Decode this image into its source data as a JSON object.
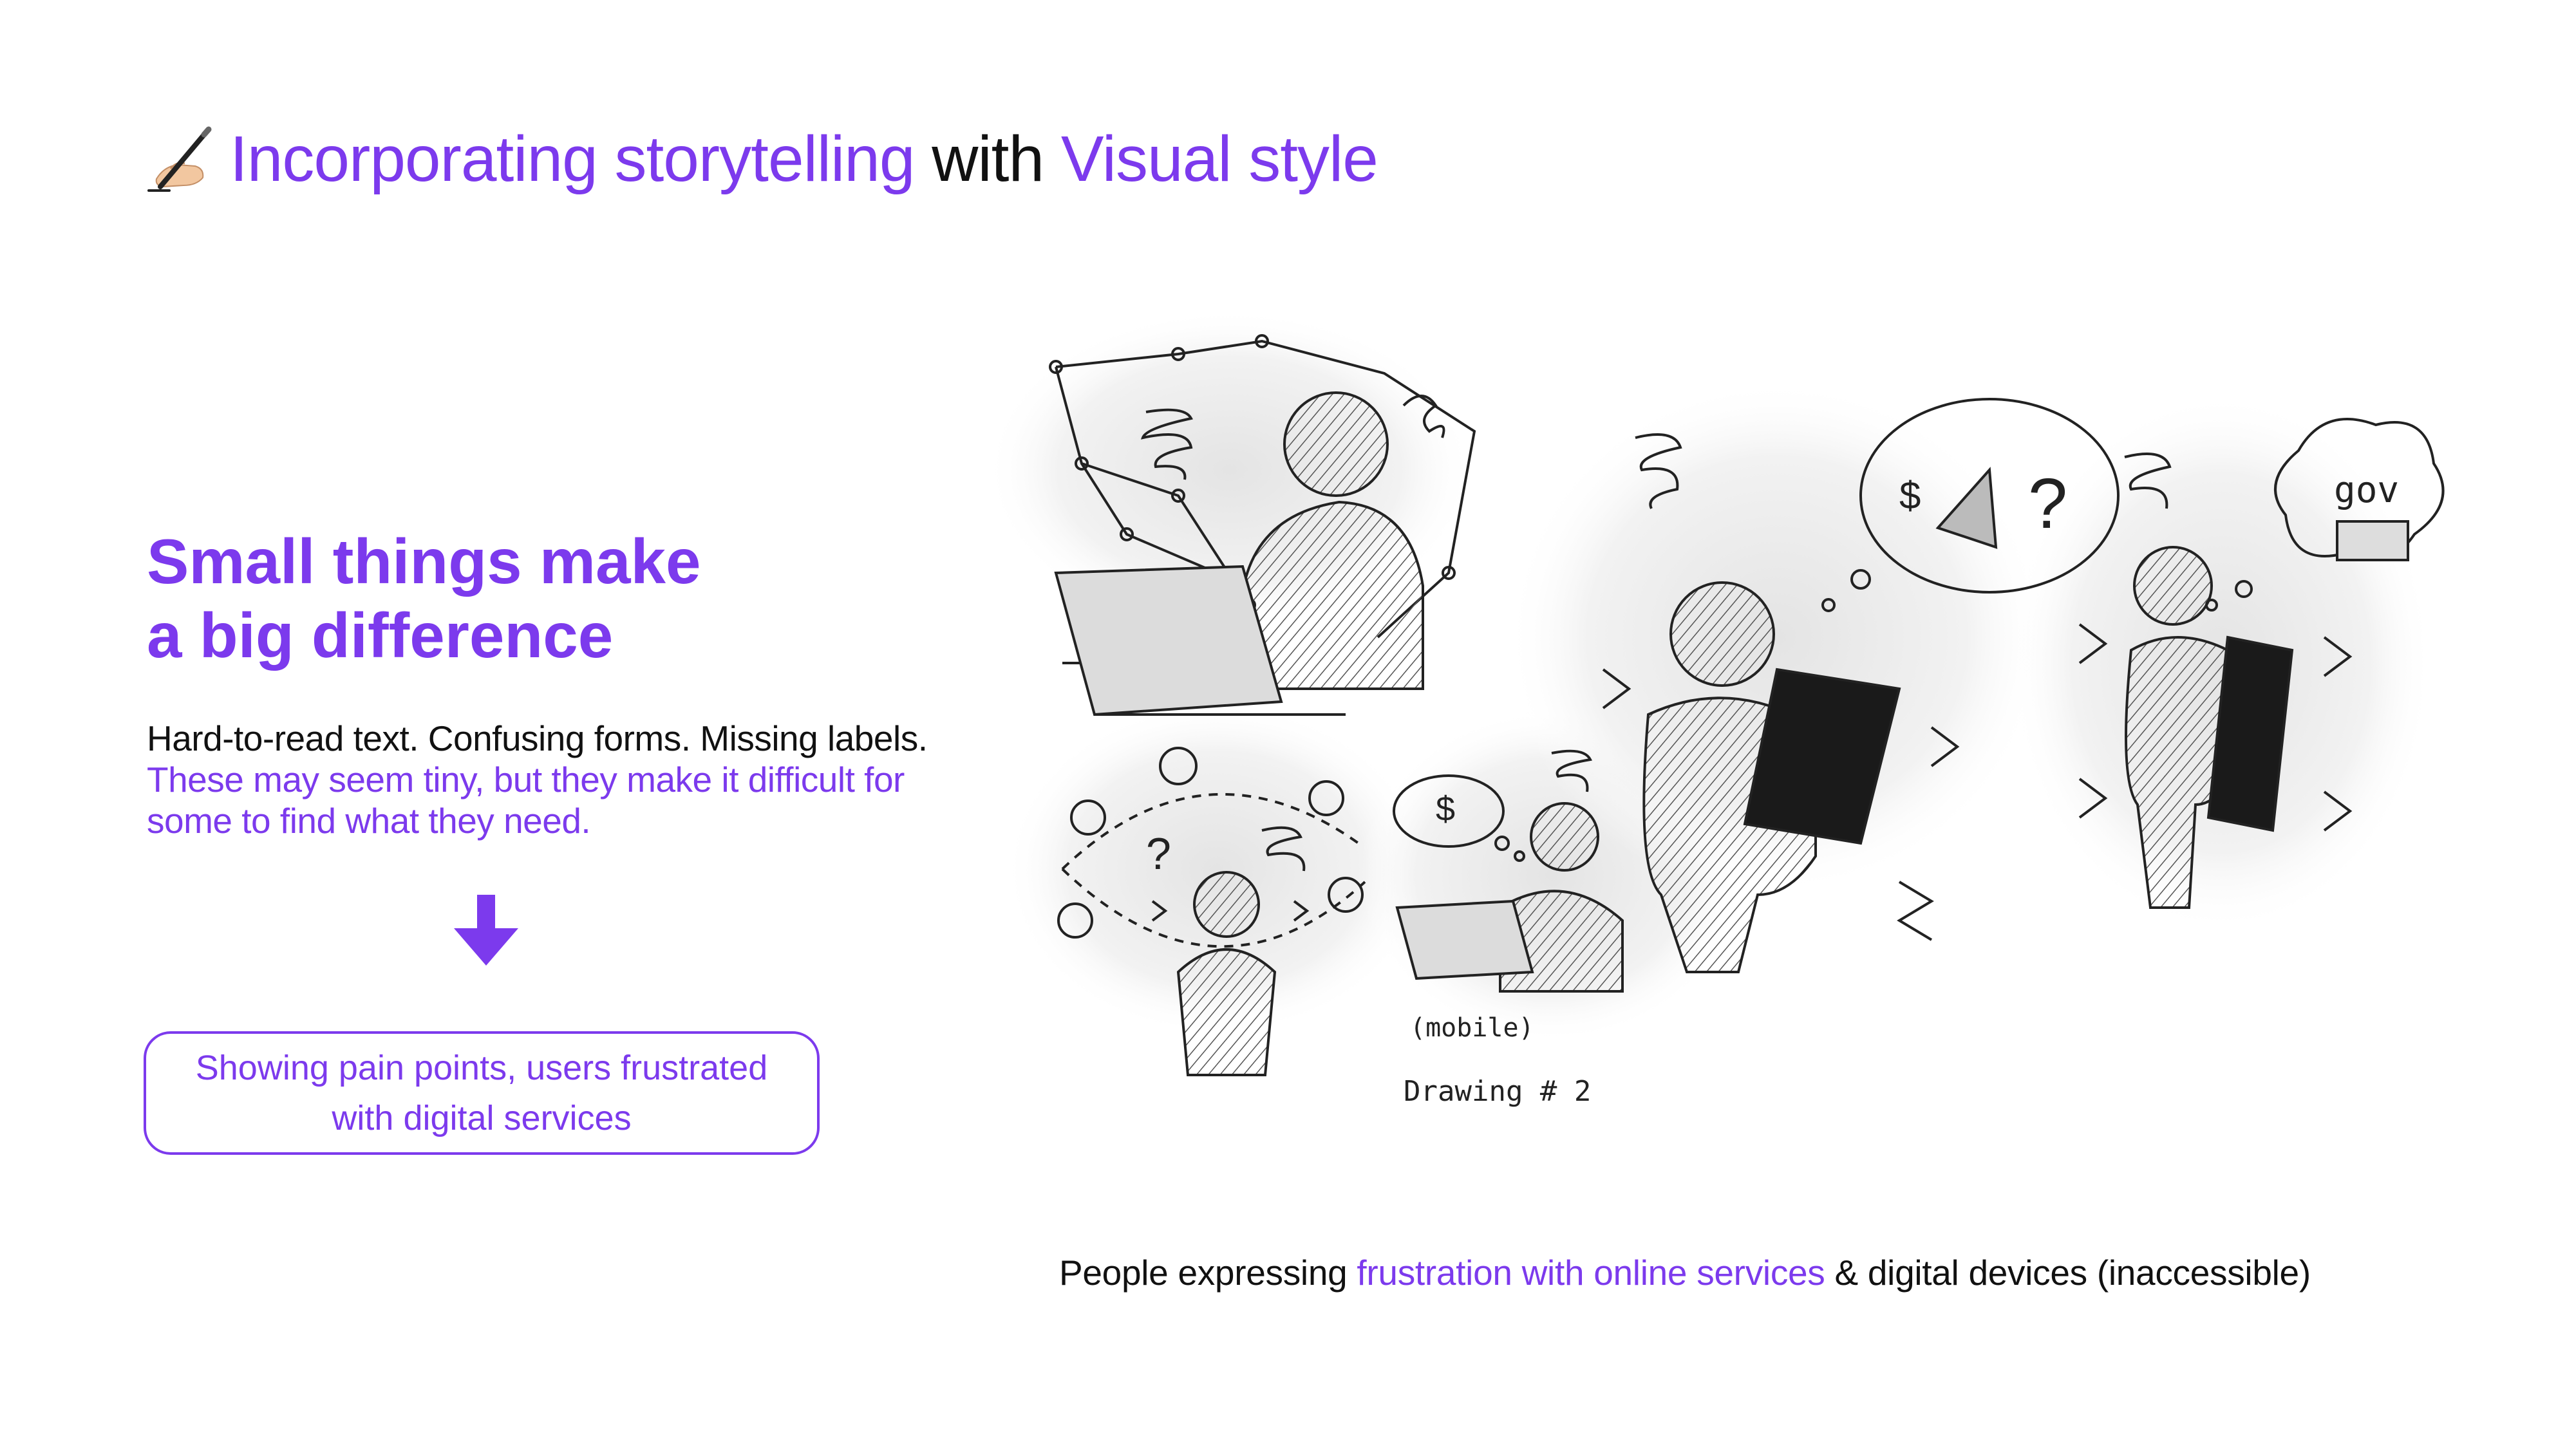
{
  "title": {
    "icon": "writing-hand-icon",
    "part1": "Incorporating storytelling",
    "part2": "with",
    "part3": "Visual style"
  },
  "headline": {
    "line1": "Small things make",
    "line2": "a big difference"
  },
  "body": {
    "plain": "Hard-to-read text. Confusing forms. Missing labels.",
    "highlight": "These may seem tiny, but they make it difficult for some to find what they need."
  },
  "arrow_icon": "arrow-down-icon",
  "caption_box": {
    "line1": "Showing pain points, users frustrated",
    "line2": "with digital services"
  },
  "sketches": {
    "label_mobile": "(mobile)",
    "label_drawing": "Drawing # 2",
    "label_gov": "gov",
    "symbol_dollar": "$",
    "symbol_question": "?"
  },
  "footer": {
    "part1": "People expressing",
    "part2": "frustration with online services",
    "part3": "& digital devices (inaccessible)"
  },
  "colors": {
    "accent": "#7c3aed",
    "text": "#111111",
    "background": "#ffffff"
  }
}
